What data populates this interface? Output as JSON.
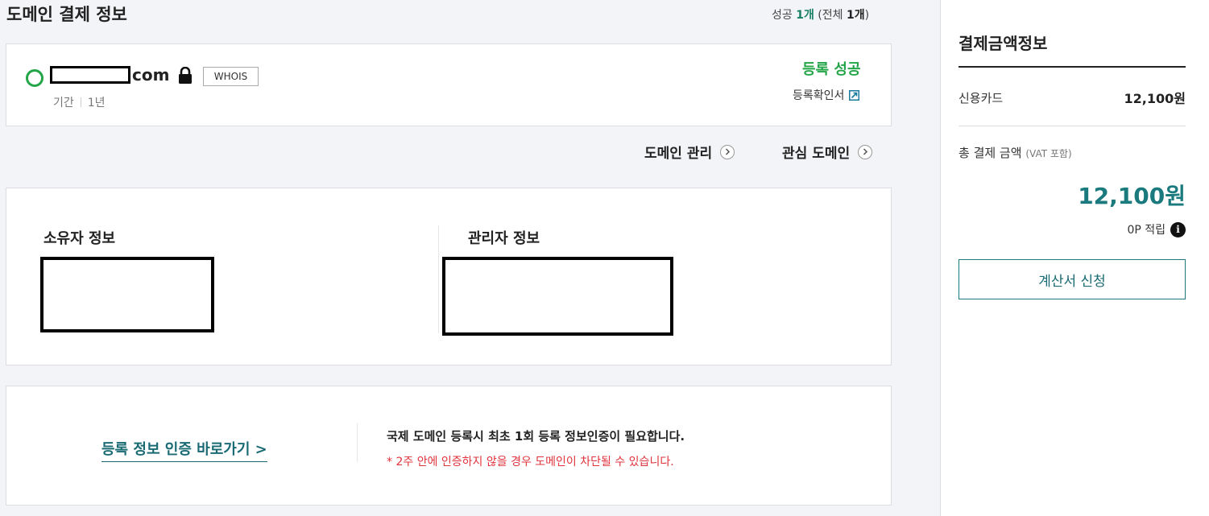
{
  "header": {
    "title": "도메인 결제 정보",
    "summary": {
      "success_label": "성공",
      "success_count": "1개",
      "total_open": "(전체",
      "total_count": "1개",
      "total_close": ")"
    }
  },
  "domain": {
    "name_suffix": "com",
    "whois_label": "WHOIS",
    "period_label": "기간",
    "period_value": "1년",
    "status": "등록 성공",
    "certificate_label": "등록확인서",
    "status_color": "#23a548"
  },
  "nav": {
    "domain_management": "도메인 관리",
    "favorite_domain": "관심 도메인"
  },
  "contacts": {
    "owner_title": "소유자 정보",
    "admin_title": "관리자 정보"
  },
  "verification": {
    "link_label": "등록 정보 인증 바로가기 >",
    "notice": "국제 도메인 등록시 최초 1회 등록 정보인증이 필요합니다.",
    "warning": "* 2주 안에 인증하지 않을 경우 도메인이 차단될 수 있습니다."
  },
  "payment": {
    "title": "결제금액정보",
    "method_label": "신용카드",
    "method_amount": "12,100원",
    "total_label": "총 결제 금액",
    "vat_note": "(VAT 포함)",
    "total_amount": "12,100원",
    "points_label": "0P 적립",
    "info_icon": "i",
    "invoice_button": "계산서 신청",
    "accent_color": "#1a7a7d"
  }
}
